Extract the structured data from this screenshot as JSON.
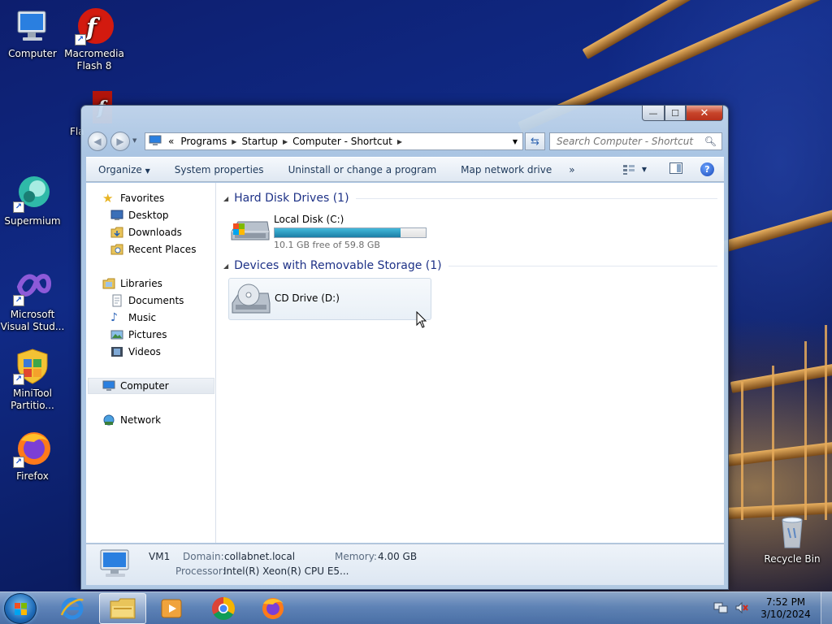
{
  "desktop": {
    "icons": [
      {
        "label": "Computer",
        "icon": "computer-icon"
      },
      {
        "label": "Macromedia Flash 8",
        "icon": "flash-icon"
      },
      {
        "label": "Fla",
        "icon": "flash-icon"
      },
      {
        "label": "Supermium",
        "icon": "supermium-icon"
      },
      {
        "label": "Microsoft Visual Stud...",
        "icon": "visual-studio-icon"
      },
      {
        "label": "MiniTool Partitio...",
        "icon": "minitool-icon"
      },
      {
        "label": "Firefox",
        "icon": "firefox-icon"
      },
      {
        "label": "Recycle Bin",
        "icon": "recycle-bin-icon"
      }
    ]
  },
  "window": {
    "caption": {
      "minimize": "—",
      "maximize": "☐",
      "close": "✕"
    },
    "breadcrumbs": [
      "Programs",
      "Startup",
      "Computer - Shortcut"
    ],
    "breadcrumb_prefix": "«",
    "search_placeholder": "Search Computer - Shortcut",
    "toolbar": {
      "organize": "Organize",
      "system_properties": "System properties",
      "uninstall": "Uninstall or change a program",
      "map_drive": "Map network drive",
      "more": "»"
    },
    "nav": {
      "favorites": "Favorites",
      "desktop": "Desktop",
      "downloads": "Downloads",
      "recent_places": "Recent Places",
      "libraries": "Libraries",
      "documents": "Documents",
      "music": "Music",
      "pictures": "Pictures",
      "videos": "Videos",
      "computer": "Computer",
      "network": "Network"
    },
    "groups": {
      "hard_disk": "Hard Disk Drives (1)",
      "removable": "Devices with Removable Storage (1)"
    },
    "drives": {
      "c_name": "Local Disk (C:)",
      "c_free": "10.1 GB free of 59.8 GB",
      "c_used_fraction": 0.831,
      "d_name": "CD Drive (D:)"
    },
    "details": {
      "name": "VM1",
      "domain_label": "Domain:",
      "domain_value": "collabnet.local",
      "memory_label": "Memory:",
      "memory_value": "4.00 GB",
      "processor_label": "Processor:",
      "processor_value": "Intel(R) Xeon(R) CPU E5..."
    }
  },
  "taskbar": {
    "apps": [
      "internet-explorer-icon",
      "file-explorer-icon",
      "media-player-icon",
      "chrome-icon",
      "firefox-icon"
    ],
    "time": "7:52 PM",
    "date": "3/10/2024"
  },
  "colors": {
    "accent": "#1e3287",
    "toolbar_text": "#1e395b",
    "disk_fill": "#1b7ea6",
    "close_button": "#c7442a"
  }
}
